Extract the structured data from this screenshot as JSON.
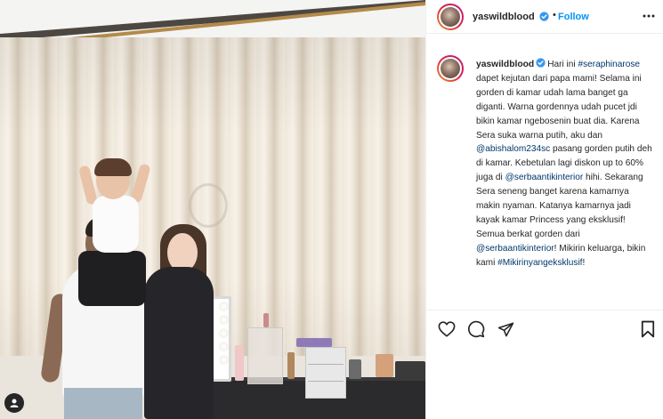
{
  "post": {
    "username": "yaswildblood",
    "verified": true,
    "follow_label": "Follow",
    "separator": "•"
  },
  "caption": {
    "username": "yaswildblood",
    "seg1": "Hari ini ",
    "tag1": "#seraphinarose",
    "seg2": " dapet kejutan dari papa mami! Selama ini gorden di kamar udah lama banget ga diganti. Warna gordennya udah pucet jdi bikin kamar ngebosenin buat dia. Karena Sera suka warna putih, aku dan ",
    "mention1": "@abishalom234sc",
    "seg3": " pasang gorden putih deh di kamar. Kebetulan lagi diskon up to 60% juga di ",
    "mention2": "@serbaantikinterior",
    "seg4": " hihi. Sekarang Sera seneng banget karena kamarnya makin nyaman. Katanya kamarnya jadi kayak kamar Princess yang eksklusif! Semua berkat gorden dari ",
    "mention3": "@serbaantikinterior",
    "seg5": "! Mikirin keluarga, bikin kami ",
    "tag2": "#Mikirinyangeksklusif",
    "seg6": "!"
  },
  "icons": {
    "verified": "verified-badge-icon",
    "more": "more-options-icon",
    "like": "heart-icon",
    "comment": "comment-icon",
    "share": "paper-plane-icon",
    "save": "bookmark-icon",
    "tagged_user": "user-icon"
  },
  "colors": {
    "link": "#00376b",
    "follow": "#0095f6",
    "verified": "#3897f0",
    "text": "#262626"
  }
}
